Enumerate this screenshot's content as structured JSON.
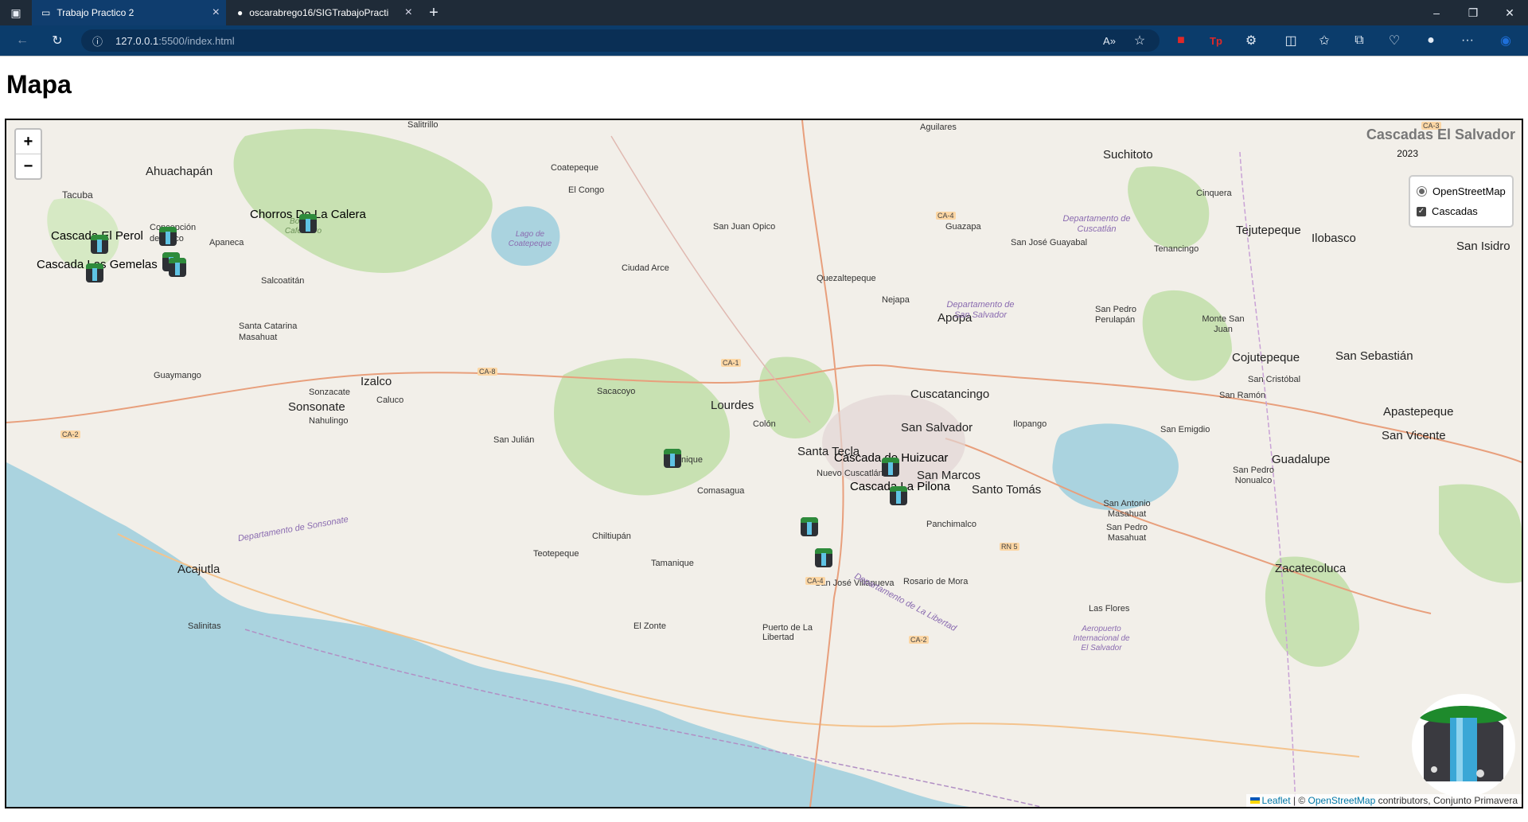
{
  "browser": {
    "tabs": [
      {
        "title": "Trabajo Practico 2",
        "active": true
      },
      {
        "title": "oscarabrego16/SIGTrabajoPractic",
        "active": false
      }
    ],
    "url_host": "127.0.0.1",
    "url_path": ":5500/index.html"
  },
  "page": {
    "heading": "Mapa"
  },
  "map": {
    "title": "Cascadas El Salvador",
    "year": "2023",
    "layers": {
      "base": "OpenStreetMap",
      "overlay": "Cascadas",
      "overlay_checked": true
    },
    "zoom_in": "+",
    "zoom_out": "−",
    "attribution": {
      "leaflet": "Leaflet",
      "sep1": " | © ",
      "osm": "OpenStreetMap",
      "rest": " contributors, Conjunto Primavera"
    },
    "markers": [
      {
        "label": "Chorros De La Calera"
      },
      {
        "label": "Cascada El Perol"
      },
      {
        "label": "Cascada Las Gemelas"
      },
      {
        "label": "Cascada de Huizucar"
      },
      {
        "label": "Cascada La Pilona"
      }
    ],
    "places": [
      "Ahuachapán",
      "Tacuba",
      "Concepción de Ataco",
      "Apaneca",
      "Salcoatitán",
      "Santa Catarina Masahuat",
      "Guaymango",
      "Izalco",
      "Sonzacate",
      "Sonsonate",
      "Nahulingo",
      "Caluco",
      "Acajutla",
      "Salinitas",
      "Coatepeque",
      "El Congo",
      "Ciudad Arce",
      "San Juan Opico",
      "Quezaltepeque",
      "Nejapa",
      "Apopa",
      "Sacacoyo",
      "Lourdes",
      "Colón",
      "San Julián",
      "Talnique",
      "Comasagua",
      "Chiltiupán",
      "Teotepeque",
      "Tamanique",
      "El Zonte",
      "Puerto de La Libertad",
      "Santa Tecla",
      "Nuevo Cuscatlán",
      "San Salvador",
      "Cuscatancingo",
      "San Marcos",
      "Santo Tomás",
      "Ilopango",
      "Panchimalco",
      "San José Villanueva",
      "Rosario de Mora",
      "Aguilares",
      "Suchitoto",
      "Guazapa",
      "Cinquera",
      "San José Guayabal",
      "Tenancingo",
      "Tejutepeque",
      "Ilobasco",
      "San Isidro",
      "San Pedro Perulapán",
      "Monte San Juan",
      "Cojutepeque",
      "San Cristóbal",
      "San Ramón",
      "San Sebastián",
      "Apastepeque",
      "San Vicente",
      "San Emigdio",
      "Guadalupe",
      "San Pedro Nonualco",
      "San Antonio Masahuat",
      "San Pedro Masahuat",
      "Zacatecoluca",
      "Las Flores",
      "Salitrillo"
    ],
    "regions": [
      "Departamento de Cuscatlán",
      "Departamento de San Salvador",
      "Departamento de La Libertad",
      "Departamento de Sonsonate",
      "Lago de Coatepeque",
      "Bosque Cafetalero",
      "Aeropuerto Internacional de El Salvador"
    ],
    "roads": [
      "CA-8",
      "CA-1",
      "CA-2",
      "CA-4",
      "CA-3",
      "RN 5"
    ]
  }
}
